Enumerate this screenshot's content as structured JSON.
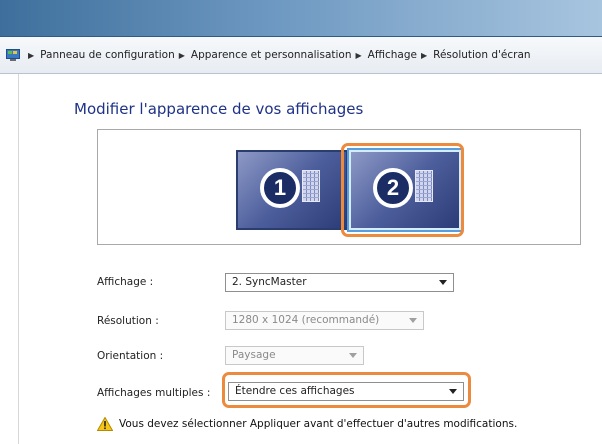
{
  "breadcrumb": {
    "items": [
      "Panneau de configuration",
      "Apparence et personnalisation",
      "Affichage",
      "Résolution d'écran"
    ]
  },
  "page": {
    "title": "Modifier l'apparence de vos affichages"
  },
  "monitors": [
    {
      "number": "1",
      "selected": false
    },
    {
      "number": "2",
      "selected": true
    }
  ],
  "settings": {
    "display_label": "Affichage :",
    "display_value": "2. SyncMaster",
    "resolution_label": "Résolution :",
    "resolution_value": "1280 x 1024 (recommandé)",
    "orientation_label": "Orientation :",
    "orientation_value": "Paysage",
    "multiple_label": "Affichages multiples :",
    "multiple_value": "Étendre ces affichages"
  },
  "warning": {
    "text": "Vous devez sélectionner Appliquer avant d'effectuer d'autres modifications.",
    "icon": "warning-icon"
  },
  "colors": {
    "highlight": "#ec8a3d",
    "title": "#1e3287",
    "title_bar": "#3e6f9c"
  }
}
